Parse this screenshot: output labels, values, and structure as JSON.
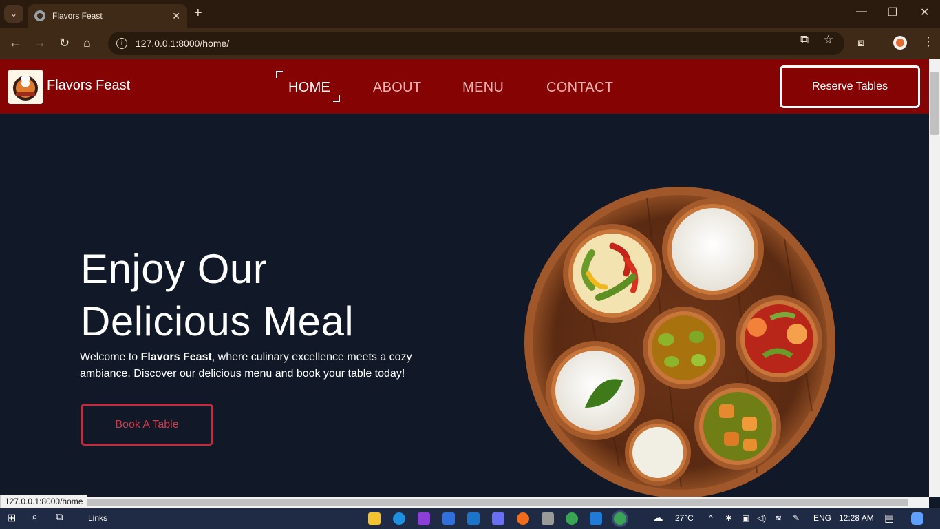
{
  "browser": {
    "tab_title": "Flavors Feast",
    "url": "127.0.0.1:8000/home/",
    "status_url": "127.0.0.1:8000/home"
  },
  "site": {
    "brand": "Flavors Feast",
    "nav": [
      "HOME",
      "ABOUT",
      "MENU",
      "CONTACT"
    ],
    "active_nav": "HOME",
    "reserve_label": "Reserve Tables"
  },
  "hero": {
    "title_line1": "Enjoy Our",
    "title_line2": "Delicious Meal",
    "desc_prefix": "Welcome to ",
    "desc_brand": "Flavors Feast",
    "desc_suffix": ", where culinary excellence meets a cozy ambiance. Discover our delicious menu and book your table today!",
    "cta_label": "Book A Table"
  },
  "taskbar": {
    "links_label": "Links",
    "weather": "27°C",
    "language": "ENG",
    "time": "12:28 AM"
  },
  "colors": {
    "nav_bg": "#850303",
    "hero_bg": "#111827",
    "cta_accent": "#c52a3d"
  }
}
